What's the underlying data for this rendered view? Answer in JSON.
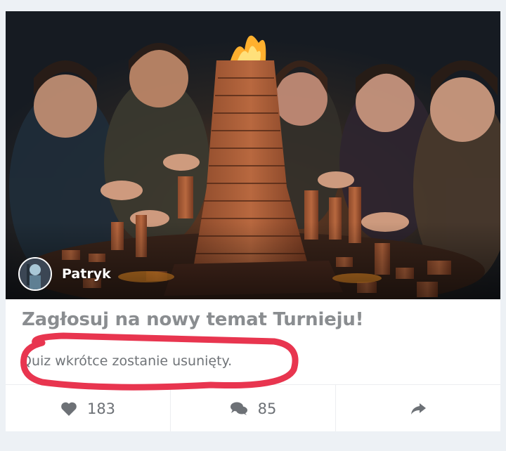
{
  "post": {
    "author": "Patryk",
    "title": "Zagłosuj na nowy temat Turnieju!",
    "subtitle": "Quiz wkrótce zostanie usunięty."
  },
  "actions": {
    "likes": "183",
    "comments": "85",
    "like_icon": "heart-icon",
    "comment_icon": "comments-icon",
    "share_icon": "share-icon"
  },
  "colors": {
    "title": "#8a8d90",
    "annotation": "#e8354f",
    "page_background": "#edf1f5"
  }
}
